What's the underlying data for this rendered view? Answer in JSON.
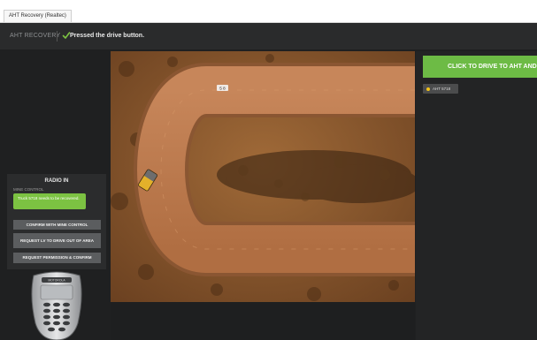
{
  "window": {
    "title": "AHT Recovery (Realtec)"
  },
  "header": {
    "app_name": "AHT RECOVERY",
    "status_text": "Pressed the drive button.",
    "status_icon": "check-icon"
  },
  "radio": {
    "title": "RADIO IN",
    "channel_label": "MINE CONTROL",
    "message": "Truck 5718 needs to be recovered.",
    "buttons": [
      {
        "label": "CONFIRM WITH MINE CONTROL"
      },
      {
        "label": "REQUEST LV TO DRIVE OUT OF AREA"
      },
      {
        "label": "REQUEST PERMISSION & CONFIRM"
      }
    ],
    "device_brand": "MOTOROLA"
  },
  "map": {
    "vehicle_tag": "5 8"
  },
  "right_panel": {
    "drive_button_label": "CLICK TO DRIVE TO AHT AND",
    "vehicle_chip_label": "AHT 5718"
  },
  "colors": {
    "accent_green": "#6dbb45",
    "message_green": "#7cc242",
    "chip_yellow": "#f2c318",
    "panel_dark": "#1f2021"
  }
}
